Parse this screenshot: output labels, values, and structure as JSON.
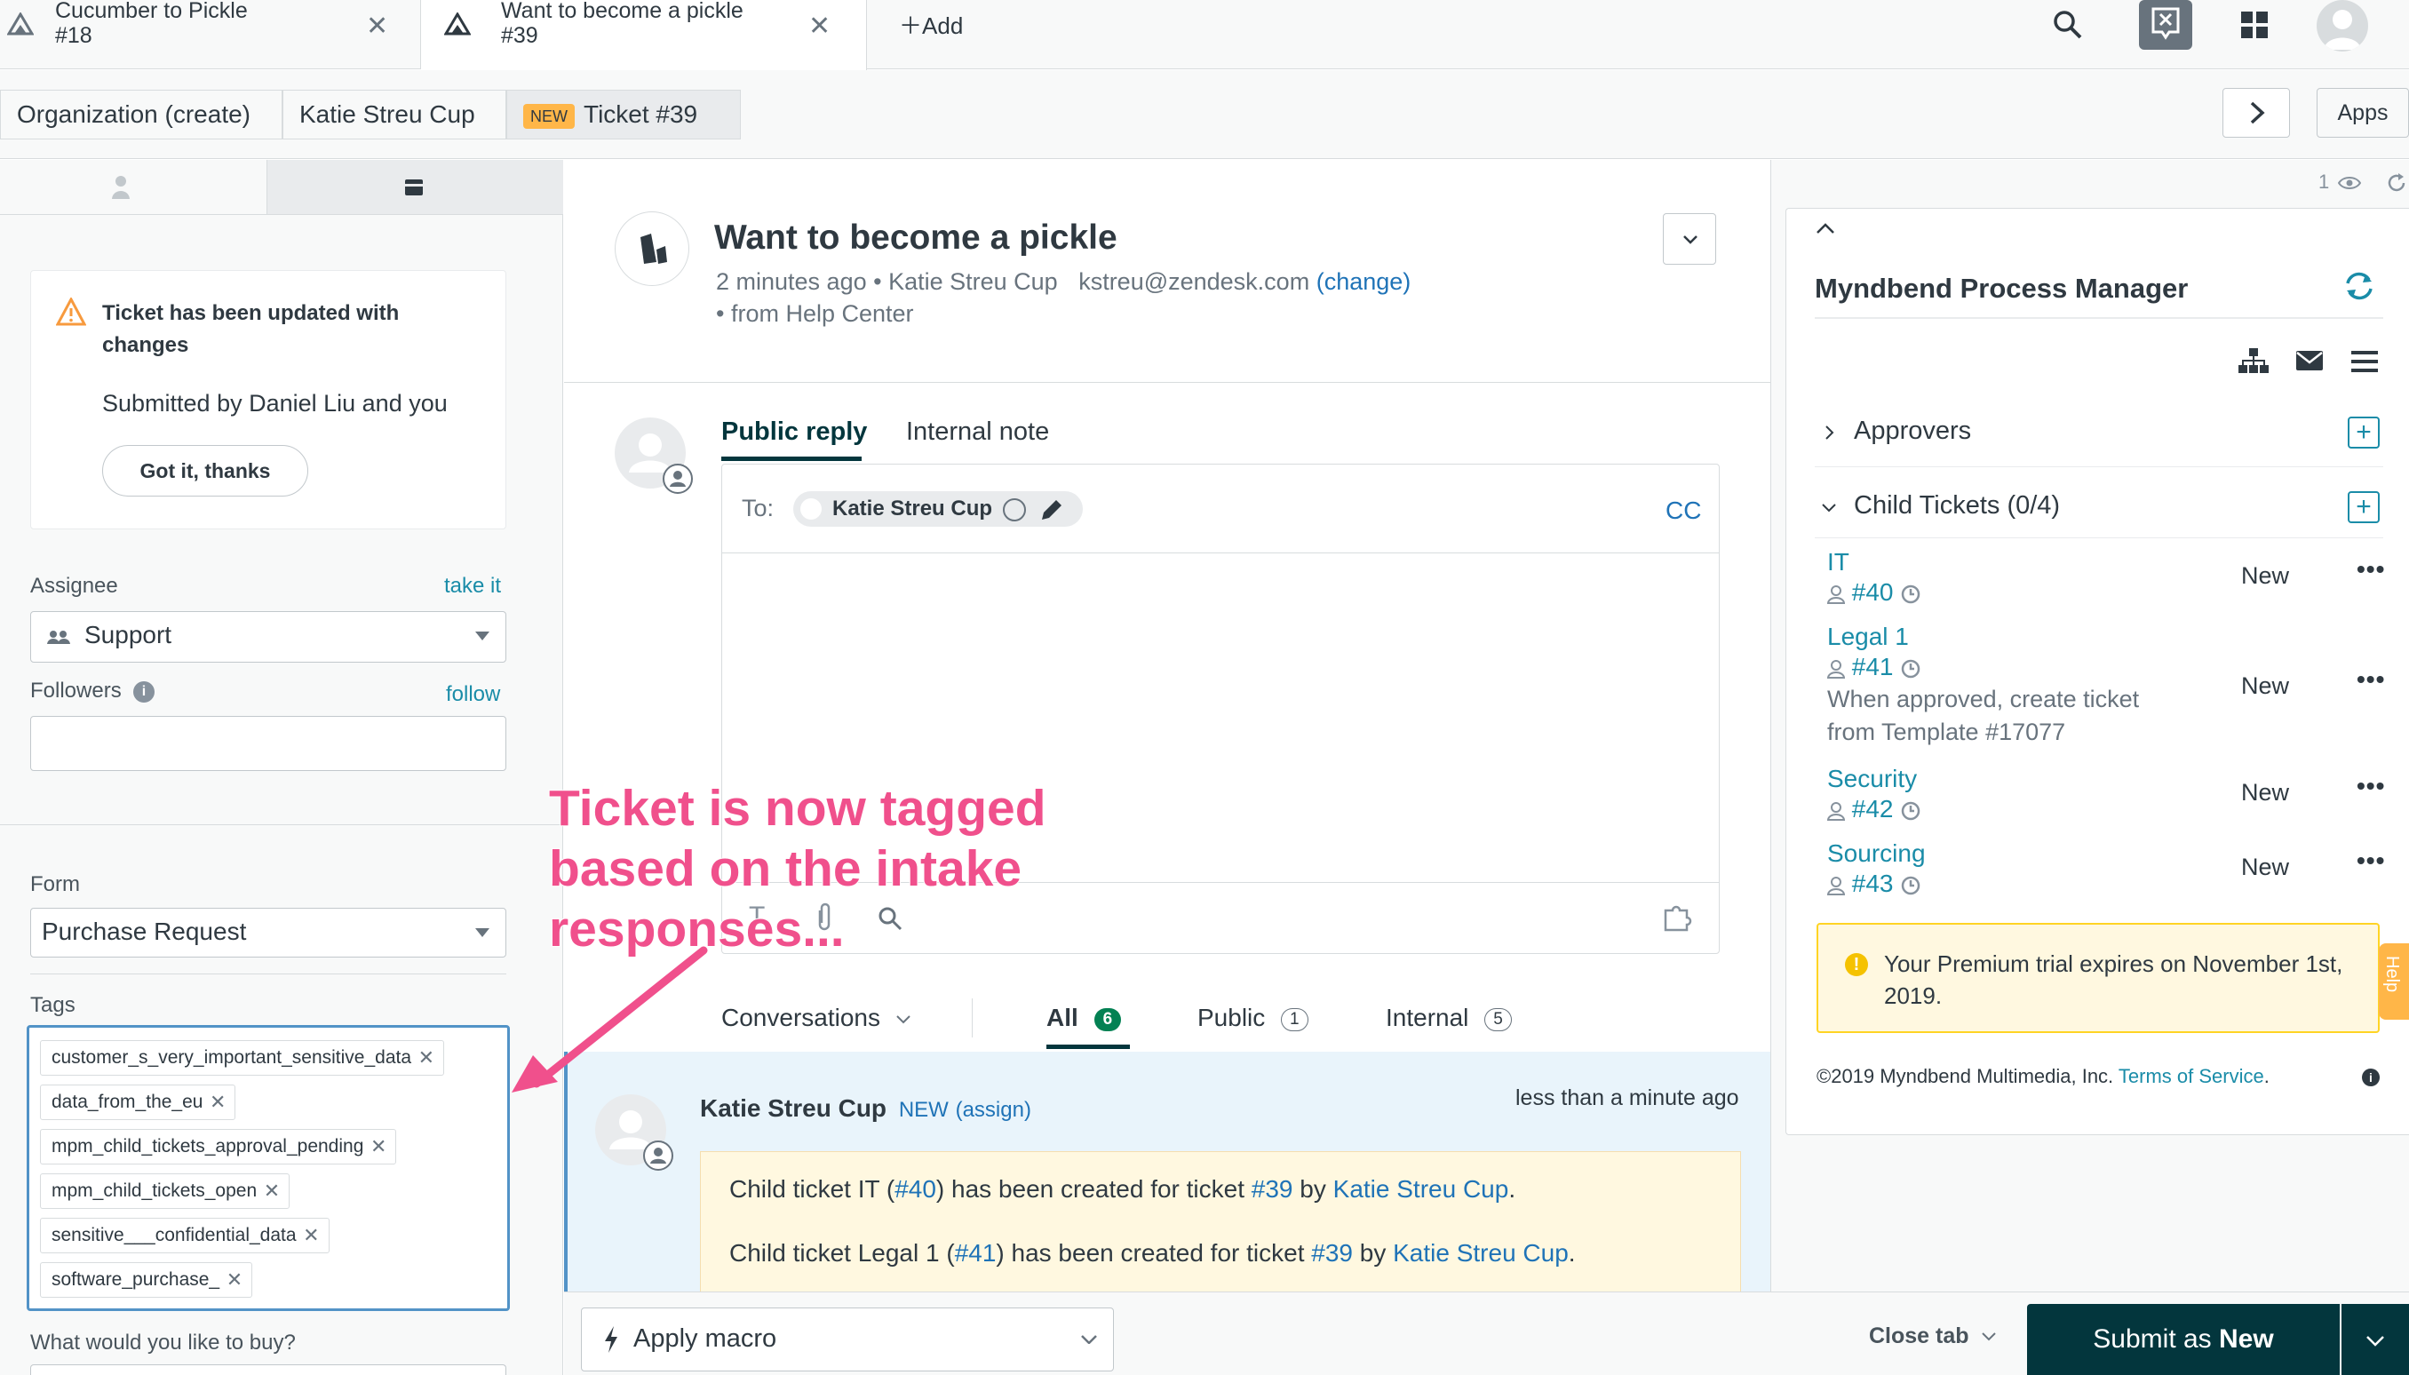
{
  "tabs": [
    {
      "title": "Cucumber to Pickle",
      "sub": "#18"
    },
    {
      "title": "Want to become a pickle",
      "sub": "#39"
    }
  ],
  "add_tab_label": "Add",
  "breadcrumbs": {
    "org": "Organization (create)",
    "user": "Katie Streu Cup",
    "new_badge": "NEW",
    "ticket": "Ticket #39"
  },
  "apps_label": "Apps",
  "notice": {
    "title": "Ticket has been updated with changes",
    "body": "Submitted by Daniel Liu and you",
    "button": "Got it, thanks"
  },
  "assignee": {
    "label": "Assignee",
    "action": "take it",
    "value": "Support"
  },
  "followers": {
    "label": "Followers",
    "action": "follow"
  },
  "form": {
    "label": "Form",
    "value": "Purchase Request"
  },
  "tags": {
    "label": "Tags",
    "items": [
      "customer_s_very_important_sensitive_data",
      "data_from_the_eu",
      "mpm_child_tickets_approval_pending",
      "mpm_child_tickets_open",
      "sensitive___confidential_data",
      "software_purchase_"
    ]
  },
  "buy_question": "What would you like to buy?",
  "ticket": {
    "title": "Want to become a pickle",
    "meta": "2 minutes ago • Katie Streu Cup",
    "email": "kstreu@zendesk.com",
    "change": "(change)",
    "source": "• from Help Center"
  },
  "reply": {
    "tab_public": "Public reply",
    "tab_internal": "Internal note",
    "to_label": "To:",
    "recipient": "Katie Streu Cup",
    "cc": "CC"
  },
  "conversations": {
    "label": "Conversations",
    "all": "All",
    "all_count": "6",
    "public": "Public",
    "public_count": "1",
    "internal": "Internal",
    "internal_count": "5"
  },
  "event": {
    "author": "Katie Streu Cup",
    "status": "NEW",
    "assign": "(assign)",
    "time": "less than a minute ago",
    "line1": [
      "Child ticket IT (",
      "#40",
      ") has been created for ticket ",
      "#39",
      " by ",
      "Katie Streu Cup",
      "."
    ],
    "line2": [
      "Child ticket Legal 1 (",
      "#41",
      ") has been created for ticket ",
      "#39",
      " by ",
      "Katie Streu Cup",
      "."
    ]
  },
  "annotation": "Ticket is now tagged based on the intake responses...",
  "macro_label": "Apply macro",
  "close_tab": "Close tab",
  "submit": {
    "prefix": "Submit as ",
    "status": "New"
  },
  "sidebar_counter": "1",
  "myndbend": {
    "title": "Myndbend Process Manager",
    "approvers": "Approvers",
    "child_tickets": "Child Tickets (0/4)",
    "children": [
      {
        "name": "IT",
        "id": "#40",
        "status": "New",
        "note": ""
      },
      {
        "name": "Legal 1",
        "id": "#41",
        "status": "New",
        "note": "When approved, create ticket from Template #17077"
      },
      {
        "name": "Security",
        "id": "#42",
        "status": "New",
        "note": ""
      },
      {
        "name": "Sourcing",
        "id": "#43",
        "status": "New",
        "note": ""
      }
    ],
    "trial": "Your Premium trial expires on November 1st, 2019.",
    "footer": "©2019 Myndbend Multimedia, Inc.",
    "tos": "Terms of Service",
    "help_tab": "Help"
  },
  "colors": {
    "accent_green": "#03363d",
    "teal": "#1a8ca8",
    "annotation_pink": "#f0508c",
    "link_blue": "#1f73b7",
    "badge_orange": "#ffb648"
  }
}
